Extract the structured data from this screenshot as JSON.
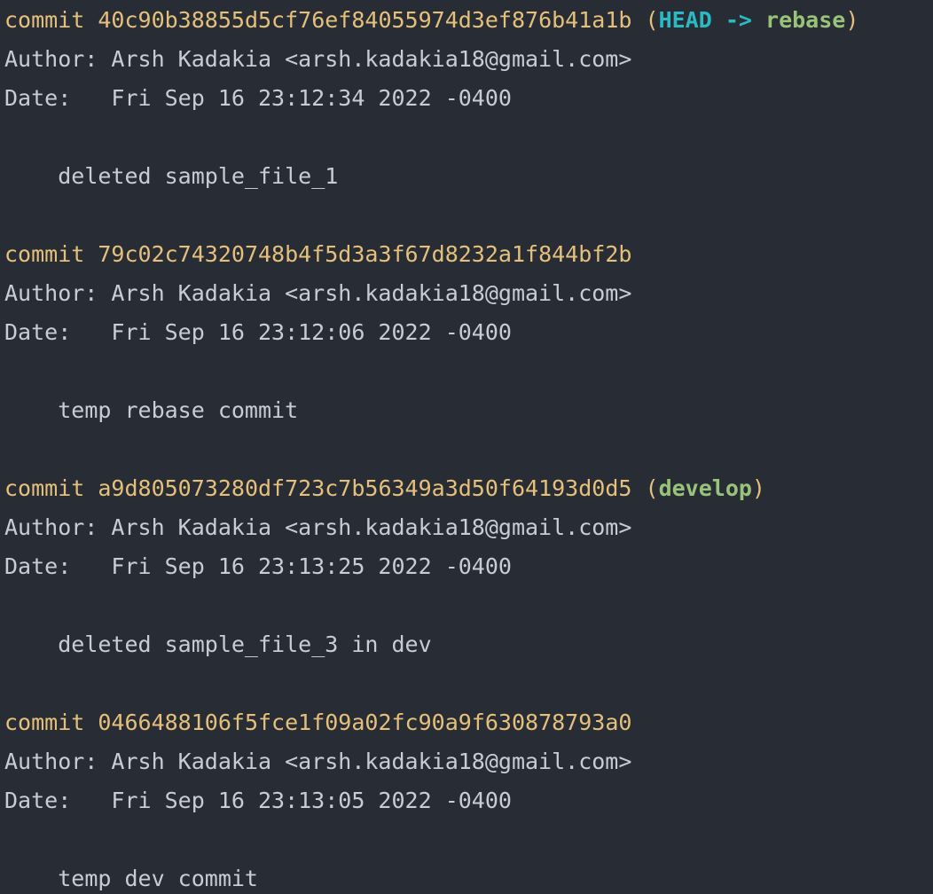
{
  "colors": {
    "background": "#282c34",
    "text": "#c8ccd4",
    "commit": "#e5c07b",
    "head": "#2bbac5",
    "branch": "#98c379"
  },
  "log": [
    {
      "commit_word": "commit",
      "hash": "40c90b38855d5cf76ef84055974d3ef876b41a1b",
      "head": "HEAD",
      "arrow": "->",
      "branch": "rebase",
      "author": "Author: Arsh Kadakia <arsh.kadakia18@gmail.com>",
      "date": "Date:   Fri Sep 16 23:12:34 2022 -0400",
      "message": "deleted sample_file_1"
    },
    {
      "commit_word": "commit",
      "hash": "79c02c74320748b4f5d3a3f67d8232a1f844bf2b",
      "author": "Author: Arsh Kadakia <arsh.kadakia18@gmail.com>",
      "date": "Date:   Fri Sep 16 23:12:06 2022 -0400",
      "message": "temp rebase commit"
    },
    {
      "commit_word": "commit",
      "hash": "a9d805073280df723c7b56349a3d50f64193d0d5",
      "branch": "develop",
      "author": "Author: Arsh Kadakia <arsh.kadakia18@gmail.com>",
      "date": "Date:   Fri Sep 16 23:13:25 2022 -0400",
      "message": "deleted sample_file_3 in dev"
    },
    {
      "commit_word": "commit",
      "hash": "0466488106f5fce1f09a02fc90a9f630878793a0",
      "author": "Author: Arsh Kadakia <arsh.kadakia18@gmail.com>",
      "date": "Date:   Fri Sep 16 23:13:05 2022 -0400",
      "message": "temp dev commit"
    }
  ]
}
